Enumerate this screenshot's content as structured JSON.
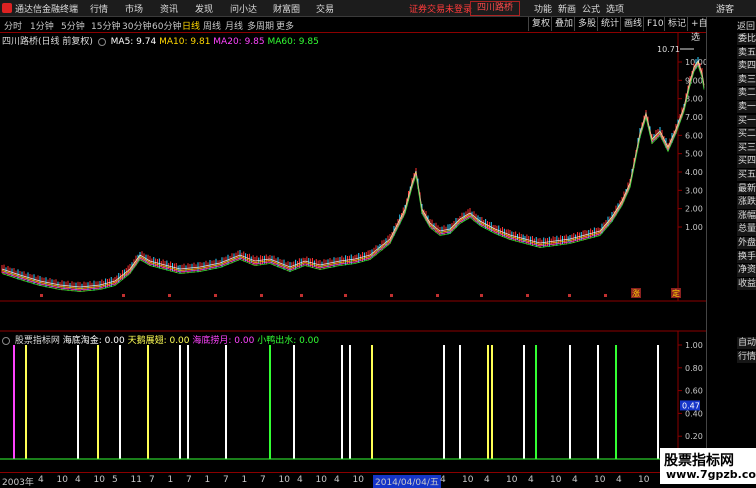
{
  "app": {
    "title": "通达信金融终端",
    "menus": [
      "行情",
      "市场",
      "资讯",
      "发现",
      "问小达",
      "财富圈",
      "交易"
    ],
    "login_notice": "证券交易未登录",
    "stock_button": "四川路桥",
    "right_menus": [
      "功能",
      "新画",
      "公式",
      "选项"
    ],
    "guest": "游客"
  },
  "periods": {
    "tabs": [
      "分时",
      "1分钟",
      "5分钟",
      "15分钟",
      "30分钟",
      "60分钟",
      "日线",
      "周线",
      "月线",
      "多周期",
      "更多"
    ],
    "active": "日线",
    "tools": [
      "复权",
      "叠加",
      "多股",
      "统计",
      "画线",
      "F10",
      "标记",
      "+自选",
      "返回"
    ]
  },
  "main_chart": {
    "stock_label": "四川路桥(日线 前复权)",
    "ma": [
      {
        "label": "MA5: 9.74",
        "color": "#ffffff"
      },
      {
        "label": "MA10: 9.81",
        "color": "#ffd700"
      },
      {
        "label": "MA20: 9.85",
        "color": "#ff44ff"
      },
      {
        "label": "MA60: 9.85",
        "color": "#33ff33"
      }
    ],
    "high_label": "10.71",
    "ticks": [
      "10.00",
      "9.00",
      "8.00",
      "7.00",
      "6.00",
      "5.00",
      "4.00",
      "3.00",
      "2.00",
      "1.00"
    ],
    "event_markers": [
      "涨",
      "定"
    ]
  },
  "indicator": {
    "name": "股票指标网",
    "signals": [
      {
        "label": "海底淘金: 0.00",
        "color": "#ffffff"
      },
      {
        "label": "天鹅展翅: 0.00",
        "color": "#ffff55"
      },
      {
        "label": "海底捞月: 0.00",
        "color": "#ff44ff"
      },
      {
        "label": "小鸭出水: 0.00",
        "color": "#33ff33"
      }
    ],
    "ticks": [
      "1.00",
      "0.80",
      "0.60",
      "0.40",
      "0.20"
    ],
    "current_value": "0.47",
    "bar_colors": [
      "#ff44ff",
      "#ffff55",
      "#ffffff",
      "#ffff55",
      "#ffffff",
      "#ffff55",
      "#ffffff",
      "#ffffff",
      "#ffffff",
      "#33ff33",
      "#ffffff",
      "#ffffff",
      "#ffffff",
      "#ffff55",
      "#ffffff",
      "#ffffff",
      "#ffff55",
      "#ffff55",
      "#ffffff",
      "#33ff33",
      "#ffffff",
      "#ffffff",
      "#33ff33",
      "#ffffff"
    ]
  },
  "sidebar": {
    "nav": [
      "游客"
    ],
    "items": [
      "委比",
      "卖五",
      "卖四",
      "卖三",
      "卖二",
      "卖一",
      "买一",
      "买二",
      "买三",
      "买四",
      "买五",
      "最新",
      "涨跌",
      "涨幅",
      "总量",
      "外盘",
      "换手",
      "净资",
      "收益",
      "自动",
      "行情"
    ]
  },
  "footer": {
    "year": "2003年",
    "date": "2014/04/04/五",
    "month_ticks_left": [
      "4",
      "10",
      "4",
      "10",
      "5",
      "11",
      "7",
      "1",
      "7",
      "1",
      "7",
      "1",
      "7",
      "10",
      "4",
      "10",
      "4",
      "10"
    ],
    "month_ticks_right": [
      "4",
      "10",
      "4",
      "10",
      "4",
      "10",
      "4",
      "10",
      "4",
      "10",
      "4"
    ]
  },
  "watermark": {
    "line1": "股票指标网",
    "line2": "www.7gpzb.com"
  }
}
